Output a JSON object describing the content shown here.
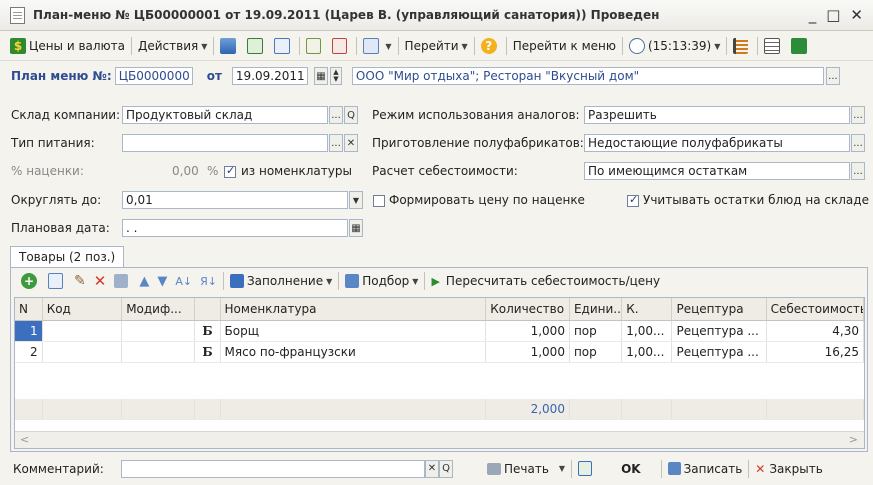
{
  "title": "План-меню № ЦБ00000001 от 19.09.2011 (Царев В. (управляющий санатория)) Проведен",
  "window_controls": {
    "minimize": "_",
    "maximize": "□",
    "close": "✕"
  },
  "toolbar": {
    "prices": "Цены и валюта",
    "actions": "Действия",
    "goto": "Перейти",
    "goto_menu": "Перейти к меню",
    "time": "(15:13:39)"
  },
  "header": {
    "menu_label": "План меню №:",
    "menu_number": "ЦБ0000000",
    "date_label": "от",
    "date": "19.09.2011",
    "org": "ООО \"Мир отдыха\"; Ресторан \"Вкусный дом\""
  },
  "form": {
    "warehouse_label": "Склад компании:",
    "warehouse": "Продуктовый склад",
    "food_type_label": "Тип питания:",
    "food_type": "",
    "markup_label": "% наценки:",
    "markup_value": "0,00",
    "markup_unit": "%",
    "from_nomenclature": "из номенклатуры",
    "round_label": "Округлять до:",
    "round_value": "0,01",
    "plan_date_label": "Плановая дата:",
    "plan_date": ". .",
    "analog_mode_label": "Режим использования аналогов:",
    "analog_mode": "Разрешить",
    "semi_label": "Приготовление полуфабрикатов:",
    "semi_value": "Недостающие полуфабрикаты",
    "cost_calc_label": "Расчет себестоимости:",
    "cost_calc": "По имеющимся остаткам",
    "markup_price": "Формировать цену по наценке",
    "account_leftovers": "Учитывать остатки блюд на складе"
  },
  "tab": {
    "label": "Товары (2 поз.)"
  },
  "table_toolbar": {
    "fill": "Заполнение",
    "select": "Подбор",
    "recalc": "Пересчитать себестоимость/цену"
  },
  "table": {
    "columns": [
      "N",
      "Код",
      "Модиф...",
      "",
      "Номенклатура",
      "Количество",
      "Едини...",
      "К.",
      "Рецептура",
      "Себестоимость"
    ],
    "rows": [
      {
        "n": "1",
        "code": "",
        "mod": "",
        "mark": "Б",
        "name": "Борщ",
        "qty": "1,000",
        "unit": "пор",
        "k": "1,00...",
        "recipe": "Рецептура ...",
        "cost": "4,30"
      },
      {
        "n": "2",
        "code": "",
        "mod": "",
        "mark": "Б",
        "name": "Мясо по-французски",
        "qty": "1,000",
        "unit": "пор",
        "k": "1,00...",
        "recipe": "Рецептура ...",
        "cost": "16,25"
      }
    ],
    "total_qty": "2,000"
  },
  "footer": {
    "comment_label": "Комментарий:",
    "comment": "",
    "print": "Печать",
    "ok": "OK",
    "save": "Записать",
    "close": "Закрыть"
  },
  "colors": {
    "accent_blue": "#2e4c8f",
    "selection": "#3d6fbf",
    "total_blue": "#3a63b0"
  }
}
